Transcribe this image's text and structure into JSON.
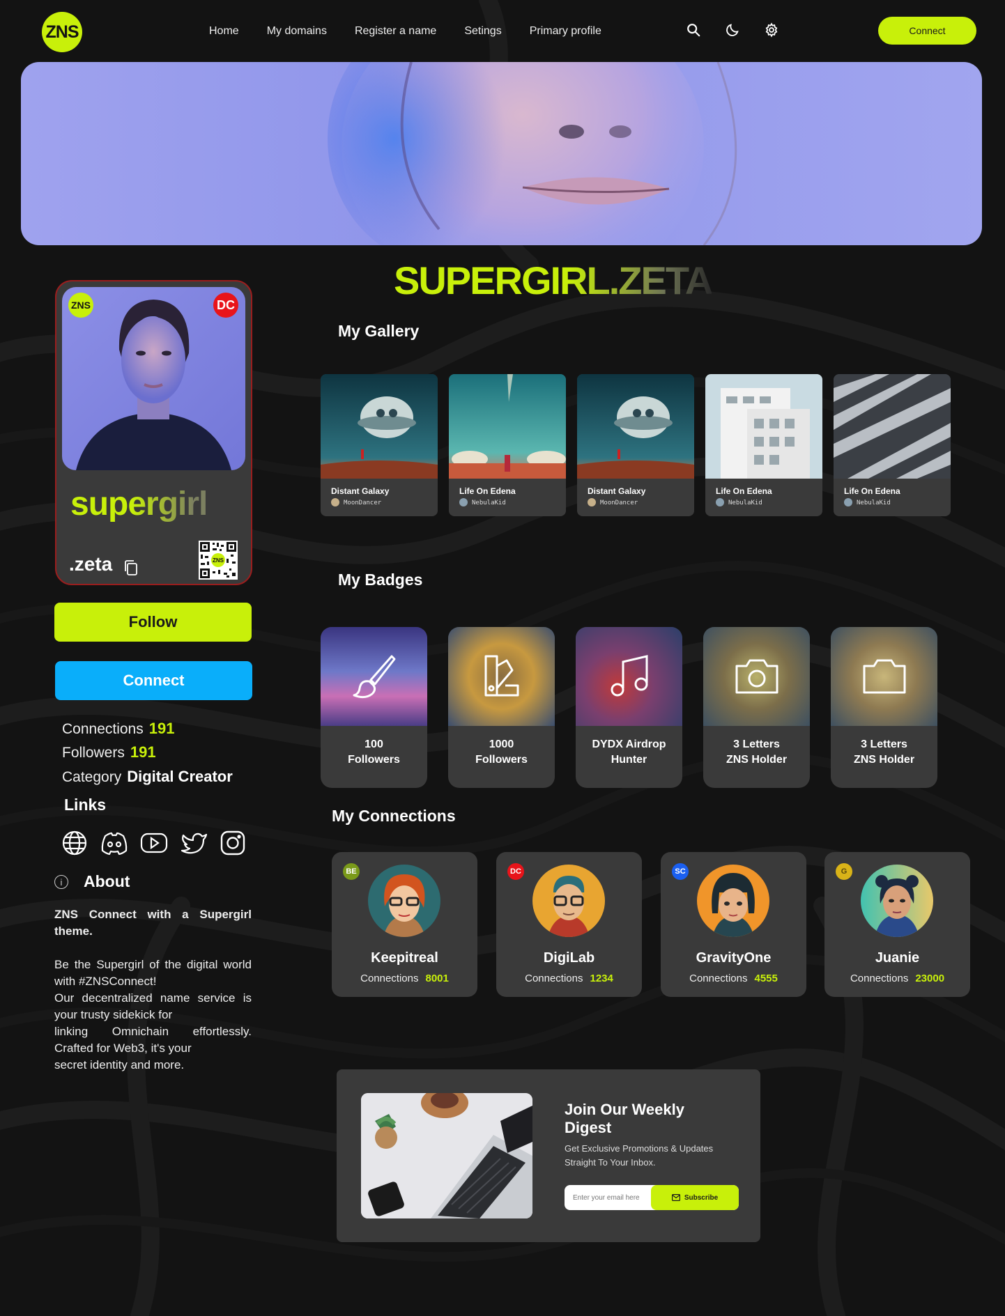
{
  "header": {
    "logo_text": "ZNS",
    "nav": [
      "Home",
      "My domains",
      "Register a name",
      "Setings",
      "Primary profile"
    ],
    "icons": [
      "search-icon",
      "moon-icon",
      "gear-icon"
    ],
    "connect_label": "Connect"
  },
  "title": "SUPERGIRL.ZETA",
  "profile": {
    "zns_badge": "ZNS",
    "dc_badge": "DC",
    "name": "supergirl",
    "suffix": ".zeta",
    "follow_label": "Follow",
    "connect_label": "Connect",
    "connections_label": "Connections",
    "connections_value": "191",
    "followers_label": "Followers",
    "followers_value": "191",
    "category_label": "Category",
    "category_value": "Digital Creator",
    "links_heading": "Links",
    "social_icons": [
      "globe-icon",
      "discord-icon",
      "youtube-icon",
      "twitter-icon",
      "instagram-icon"
    ],
    "about_heading": "About",
    "about_bold": "ZNS Connect with a Supergirl theme.",
    "about_lines": [
      "Be the Supergirl of the digital world with #ZNSConnect!",
      "Our decentralized name service is your trusty sidekick for",
      "linking Omnichain effortlessly. Crafted for Web3, it's your",
      "secret identity and more."
    ]
  },
  "gallery": {
    "heading": "My Gallery",
    "items": [
      {
        "title": "Distant Galaxy",
        "author": "MoonDancer"
      },
      {
        "title": "Life On Edena",
        "author": "NebulaKid"
      },
      {
        "title": "Distant Galaxy",
        "author": "MoonDancer"
      },
      {
        "title": "Life On Edena",
        "author": "NebulaKid"
      },
      {
        "title": "Life On Edena",
        "author": "NebulaKid"
      }
    ]
  },
  "badges": {
    "heading": "My Badges",
    "items": [
      {
        "line1": "100",
        "line2": "Followers",
        "icon": "brush-icon"
      },
      {
        "line1": "1000",
        "line2": "Followers",
        "icon": "swatch-icon"
      },
      {
        "line1": "DYDX Airdrop",
        "line2": "Hunter",
        "icon": "music-icon"
      },
      {
        "line1": "3 Letters",
        "line2": "ZNS Holder",
        "icon": "camera-icon"
      },
      {
        "line1": "3 Letters",
        "line2": "ZNS Holder",
        "icon": "folder-icon"
      }
    ]
  },
  "connections": {
    "heading": "My Connections",
    "label": "Connections",
    "items": [
      {
        "badge": "BE",
        "name": "Keepitreal",
        "count": "8001",
        "badge_color": "#7a9a1a"
      },
      {
        "badge": "DC",
        "name": "DigiLab",
        "count": "1234",
        "badge_color": "#e8141a"
      },
      {
        "badge": "SC",
        "name": "GravityOne",
        "count": "4555",
        "badge_color": "#1a5ff0"
      },
      {
        "badge": "G",
        "name": "Juanie",
        "count": "23000",
        "badge_color": "#d9b318"
      }
    ]
  },
  "newsletter": {
    "title": "Join Our Weekly Digest",
    "subtitle": "Get Exclusive Promotions & Updates Straight To Your Inbox.",
    "placeholder": "Enter your email here",
    "button": "Subscribe"
  },
  "colors": {
    "accent": "#c8f00a",
    "connect_blue": "#0aaefa",
    "card": "#3a3a3a",
    "background": "#131313"
  }
}
